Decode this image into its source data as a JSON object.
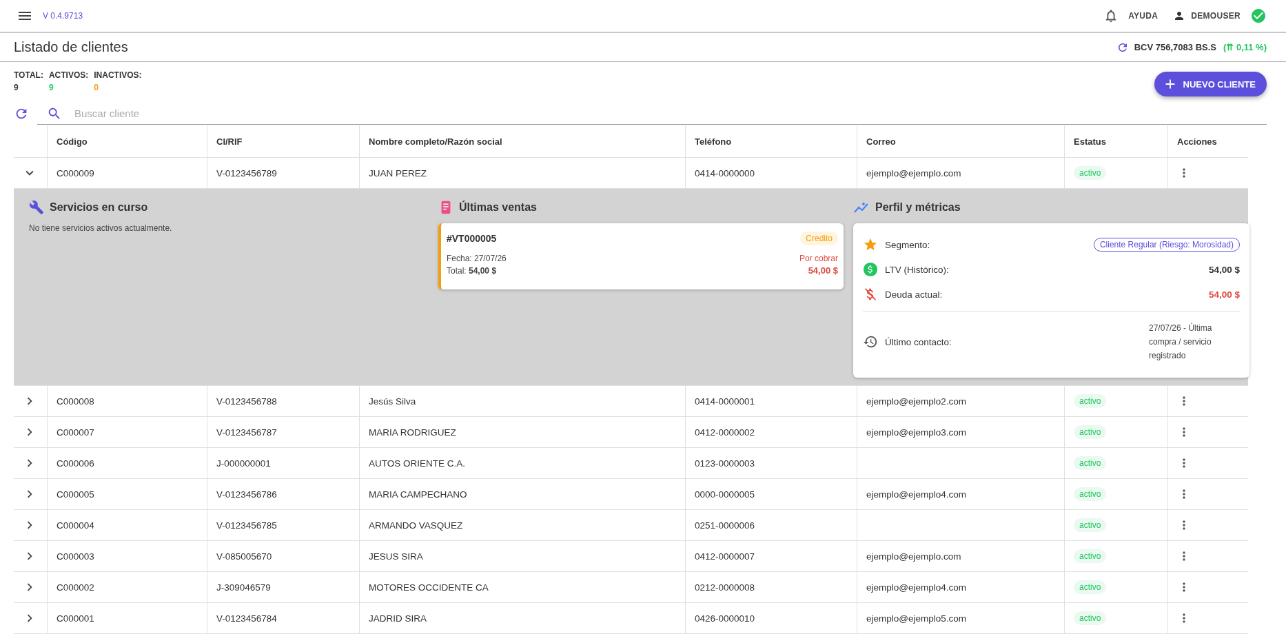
{
  "app_bar": {
    "version": "V 0.4.9713",
    "help": "AYUDA",
    "user": "DEMOUSER"
  },
  "page": {
    "title": "Listado de clientes",
    "rate": "BCV 756,7083 BS.S",
    "rate_change": "(⇈ 0,11 %)"
  },
  "stats": [
    {
      "label": "TOTAL:",
      "value": "9",
      "color": "#333333"
    },
    {
      "label": "ACTIVOS:",
      "value": "9",
      "color": "#22c55e"
    },
    {
      "label": "INACTIVOS:",
      "value": "0",
      "color": "#f59e0b"
    }
  ],
  "new_button": "NUEVO CLIENTE",
  "search": {
    "placeholder": "Buscar cliente"
  },
  "table": {
    "columns": [
      "Código",
      "CI/RIF",
      "Nombre completo/Razón social",
      "Teléfono",
      "Correo",
      "Estatus",
      "Acciones"
    ],
    "rows": [
      {
        "code": "C000009",
        "tax_id": "V-0123456789",
        "name": "JUAN PEREZ",
        "phone": "0414-0000000",
        "email": "ejemplo@ejemplo.com",
        "status": "activo",
        "expanded": true,
        "details": {
          "services": {
            "title": "Servicios en curso",
            "empty": "No tiene servicios activos actualmente."
          },
          "sales": {
            "title": "Últimas ventas",
            "items": [
              {
                "number": "#VT000005",
                "badge": "Credito",
                "date": "Fecha: 27/07/26",
                "total": "Total: **54,00 $**",
                "state": "Por cobrar",
                "amount": "54,00 $"
              }
            ]
          },
          "profile": {
            "title": "Perfil y métricas",
            "segment_label": "Segmento:",
            "segment": "Cliente Regular (Riesgo: Morosidad)",
            "ltv_label": "LTV (Histórico):",
            "ltv": "54,00 $",
            "debt_label": "Deuda actual:",
            "debt": "54,00 $",
            "contact_label": "Último contacto:",
            "contact": "27/07/26 - Última compra / servicio registrado"
          }
        }
      },
      {
        "code": "C000008",
        "tax_id": "V-0123456788",
        "name": "Jesús Silva",
        "phone": "0414-0000001",
        "email": "ejemplo@ejemplo2.com",
        "status": "activo",
        "expanded": false
      },
      {
        "code": "C000007",
        "tax_id": "V-0123456787",
        "name": "MARIA RODRIGUEZ",
        "phone": "0412-0000002",
        "email": "ejemplo@ejemplo3.com",
        "status": "activo",
        "expanded": false
      },
      {
        "code": "C000006",
        "tax_id": "J-000000001",
        "name": "AUTOS ORIENTE C.A.",
        "phone": "0123-0000003",
        "status": "activo",
        "expanded": false
      },
      {
        "code": "C000005",
        "tax_id": "V-0123456786",
        "name": "MARIA CAMPECHANO",
        "phone": "0000-0000005",
        "email": "ejemplo@ejemplo4.com",
        "status": "activo",
        "expanded": false
      },
      {
        "code": "C000004",
        "tax_id": "V-0123456785",
        "name": "ARMANDO VASQUEZ",
        "phone": "0251-0000006",
        "status": "activo",
        "expanded": false
      },
      {
        "code": "C000003",
        "tax_id": "V-085005670",
        "name": "JESUS SIRA",
        "phone": "0412-0000007",
        "email": "ejemplo@ejemplo.com",
        "status": "activo",
        "expanded": false
      },
      {
        "code": "C000002",
        "tax_id": "J-309046579",
        "name": "MOTORES OCCIDENTE CA",
        "phone": "0212-0000008",
        "email": "ejemplo@ejemplo4.com",
        "status": "activo",
        "expanded": false
      },
      {
        "code": "C000001",
        "tax_id": "V-0123456784",
        "name": "JADRID SIRA",
        "phone": "0426-0000010",
        "email": "ejemplo@ejemplo5.com",
        "status": "activo",
        "expanded": false
      }
    ]
  }
}
